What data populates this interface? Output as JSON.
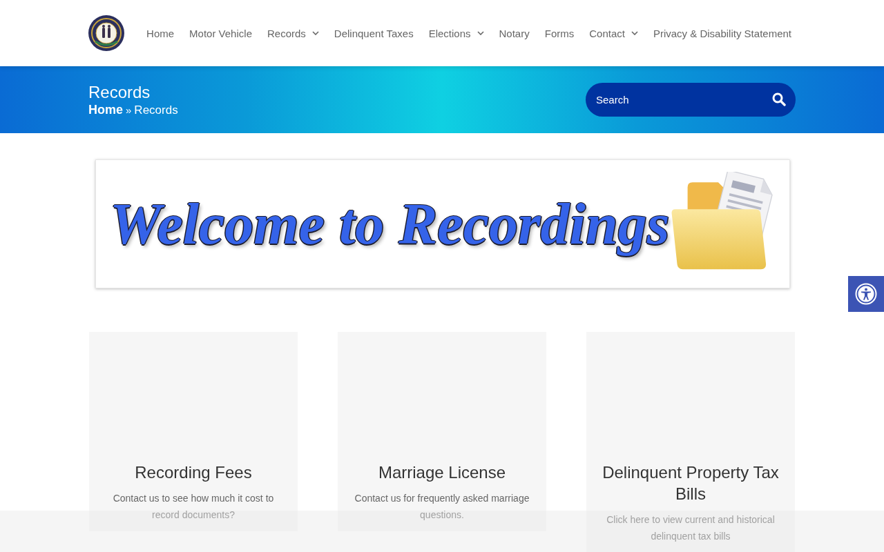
{
  "header": {
    "nav": [
      {
        "label": "Home",
        "dropdown": false
      },
      {
        "label": "Motor Vehicle",
        "dropdown": false
      },
      {
        "label": "Records",
        "dropdown": true
      },
      {
        "label": "Delinquent Taxes",
        "dropdown": false
      },
      {
        "label": "Elections",
        "dropdown": true
      },
      {
        "label": "Notary",
        "dropdown": false
      },
      {
        "label": "Forms",
        "dropdown": false
      },
      {
        "label": "Contact",
        "dropdown": true
      },
      {
        "label": "Privacy & Disability Statement",
        "dropdown": false
      }
    ]
  },
  "page_header": {
    "title": "Records",
    "breadcrumb": [
      {
        "label": "Home",
        "kind": "link"
      },
      {
        "label": "»",
        "kind": "separator"
      },
      {
        "label": "Records",
        "kind": "current"
      }
    ],
    "search": {
      "placeholder": "Search"
    }
  },
  "banner": {
    "title": "Welcome to Recordings"
  },
  "cards": [
    {
      "title": "Recording Fees",
      "text": "Contact us to see how much it cost to record documents?"
    },
    {
      "title": "Marriage License",
      "text": "Contact us for frequently asked marriage questions."
    },
    {
      "title": "Delinquent Property Tax Bills",
      "text": "Click here to view current and historical delinquent tax bills"
    }
  ]
}
